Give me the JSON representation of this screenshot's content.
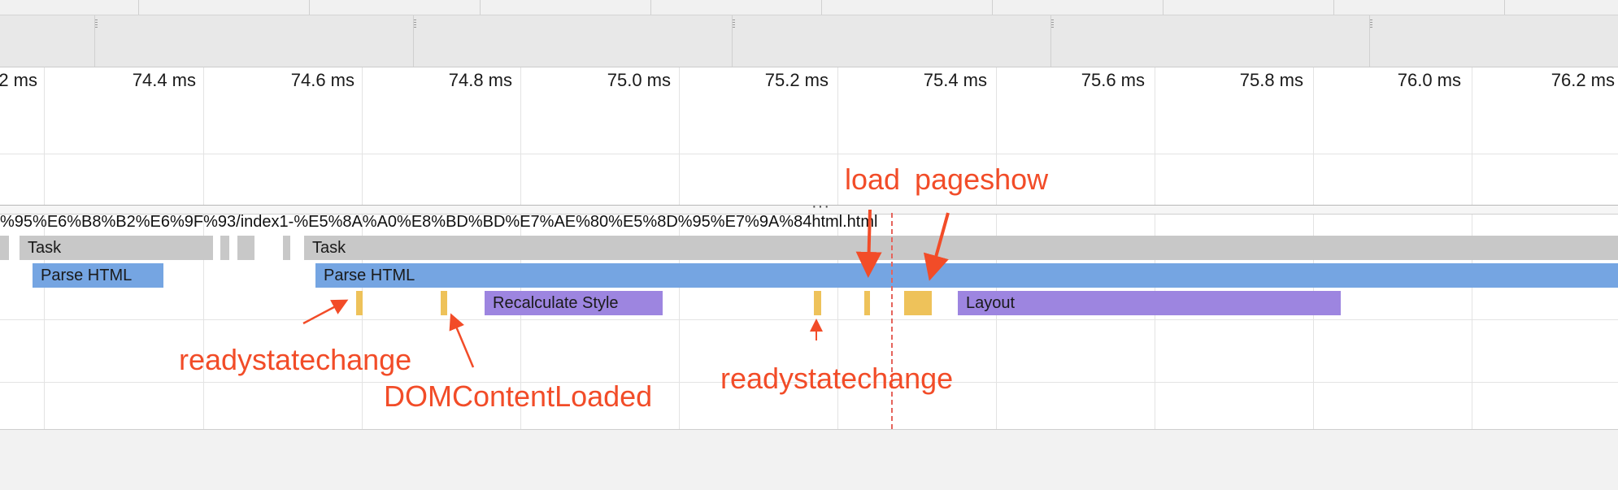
{
  "ruler": {
    "ticks": [
      "2 ms",
      "74.4 ms",
      "74.6 ms",
      "74.8 ms",
      "75.0 ms",
      "75.2 ms",
      "75.4 ms",
      "75.6 ms",
      "75.8 ms",
      "76.0 ms",
      "76.2 ms"
    ]
  },
  "flamechart": {
    "url": "%95%E6%B8%B2%E6%9F%93/index1-%E5%8A%A0%E8%BD%BD%E7%AE%80%E5%8D%95%E7%9A%84html.html",
    "tasks": [
      {
        "label": ""
      },
      {
        "label": "Task"
      },
      {
        "label": ""
      },
      {
        "label": ""
      },
      {
        "label": ""
      },
      {
        "label": "Task"
      }
    ],
    "parse_html": [
      {
        "label": "Parse HTML"
      },
      {
        "label": "Parse HTML"
      }
    ],
    "styles": [
      {
        "label": "Recalculate Style"
      },
      {
        "label": "Layout"
      }
    ]
  },
  "annotations": {
    "load": "load",
    "pageshow": "pageshow",
    "readystatechange_1": "readystatechange",
    "dom_content_loaded": "DOMContentLoaded",
    "readystatechange_2": "readystatechange"
  },
  "colors": {
    "task": "#c8c8c8",
    "parse_html": "#75a5e2",
    "rendering": "#9d85e0",
    "event": "#eec25a",
    "annotation": "#f24c28",
    "load_marker": "#e5645c"
  }
}
